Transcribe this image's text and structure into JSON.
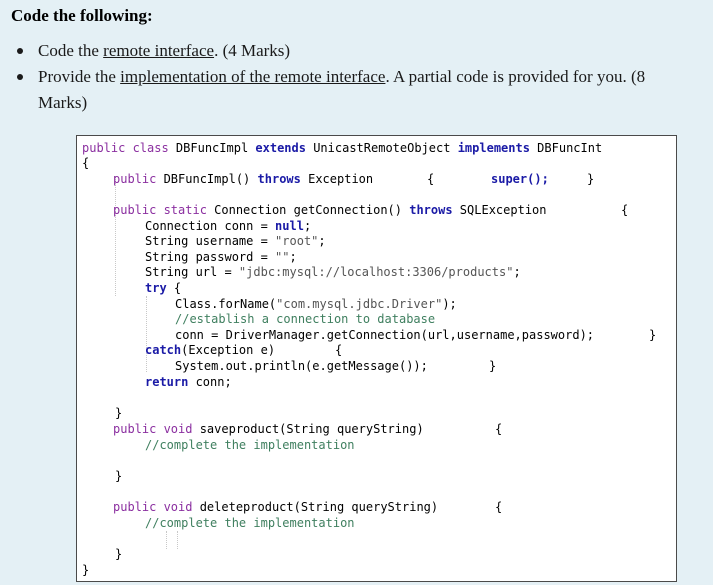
{
  "heading": "Code the following:",
  "bullets": [
    {
      "prefix": "Code the ",
      "link": "remote interface",
      "suffix": ". (4 Marks)"
    },
    {
      "prefix": "Provide the ",
      "link": "implementation of the remote interface",
      "suffix": ". A partial code is provided for you. (8 Marks)"
    }
  ],
  "code": {
    "class_decl_1": "public class",
    "class_decl_2": " DBFuncImpl ",
    "class_decl_3": "extends",
    "class_decl_4": " UnicastRemoteObject ",
    "class_decl_5": "implements",
    "class_decl_6": " DBFuncInt",
    "open_brace": "{",
    "close_brace": "}",
    "ctor_1": "public",
    "ctor_2": " DBFuncImpl() ",
    "ctor_3": "throws",
    "ctor_4": " Exception",
    "ctor_super": "super();",
    "getconn_1": "public static",
    "getconn_2": " Connection getConnection() ",
    "getconn_3": "throws",
    "getconn_4": " SQLException",
    "line_conn_1": "Connection conn = ",
    "line_conn_2": "null",
    "line_conn_3": ";",
    "line_user_1": "String username = ",
    "line_user_2": "\"root\"",
    "line_user_3": ";",
    "line_pass_1": "String password = ",
    "line_pass_2": "\"\"",
    "line_pass_3": ";",
    "line_url_1": "String url = ",
    "line_url_2": "\"jdbc:mysql://localhost:3306/products\"",
    "line_url_3": ";",
    "try_kw": "try",
    "forname_1": "Class.forName(",
    "forname_2": "\"com.mysql.jdbc.Driver\"",
    "forname_3": ");",
    "comment_establish": "//establish a connection to database",
    "getconnection_call": "conn = DriverManager.getConnection(url,username,password);",
    "catch_1": "catch",
    "catch_2": "(Exception e)",
    "println": "System.out.println(e.getMessage());",
    "return_1": "return",
    "return_2": " conn;",
    "save_1": "public void",
    "save_2": " saveproduct(String queryString)",
    "delete_1": "public void",
    "delete_2": " deleteproduct(String queryString)",
    "comment_complete": "//complete the implementation"
  }
}
